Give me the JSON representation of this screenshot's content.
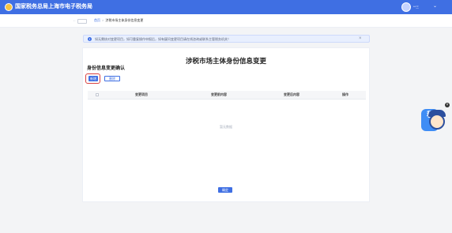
{
  "header": {
    "brand": "国家税务总局上海市电子税务局",
    "user_name": "**三",
    "menu_chevron": "⌄"
  },
  "breadcrumb": {
    "home": "首页",
    "separator": ">",
    "current": "涉税市场主体身份信息变更"
  },
  "notice": {
    "text": "如无需核对变更项目，如可重复操作申报后，如有疑问变更项目请在线咨询或联系主管税务机关！",
    "close": "×"
  },
  "main": {
    "page_title": "涉税市场主体身份信息变更",
    "section_title": "身份信息变更确认",
    "add_label": "新增",
    "delete_label": "删除",
    "table": {
      "columns": [
        "变更项目",
        "变更前内容",
        "变更后内容",
        "操作"
      ]
    },
    "empty_text": "暂无数据",
    "confirm_label": "确定"
  },
  "mascot": {
    "char1": "税",
    "char2": "动"
  },
  "colors": {
    "primary": "#3f6fe3",
    "highlight": "#d94141"
  }
}
